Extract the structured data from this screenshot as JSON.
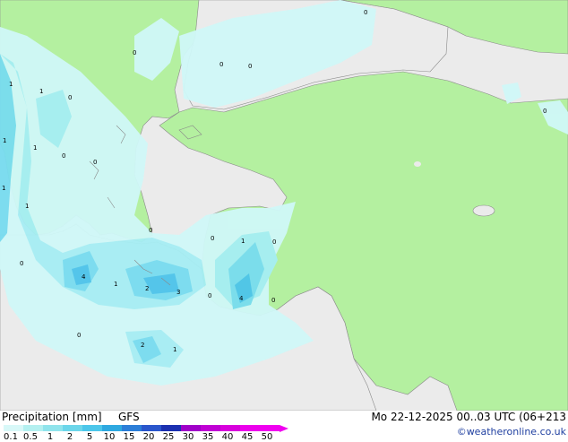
{
  "footer": {
    "title": "Precipitation [mm]",
    "model": "GFS",
    "valid": "Mo 22-12-2025 00..03 UTC (06+213",
    "credit": "©weatheronline.co.uk"
  },
  "legend": {
    "ticks": [
      "0.1",
      "0.5",
      "1",
      "2",
      "5",
      "10",
      "15",
      "20",
      "25",
      "30",
      "35",
      "40",
      "45",
      "50"
    ],
    "colors": [
      "#d8f8f8",
      "#b4f0f0",
      "#90e4ec",
      "#6cd6ea",
      "#4cc6ea",
      "#2ea8e0",
      "#2c7ed8",
      "#2a56cc",
      "#1c30b0",
      "#a000c8",
      "#c000d4",
      "#d800dc",
      "#ec00ec",
      "#f000f0"
    ]
  },
  "map": {
    "colors": {
      "sea": "#ebebeb",
      "land": "#b4f0a0",
      "precip_light": "#d0f8f8",
      "precip_mid": "#a6eef4",
      "precip_heavy": "#78dcf0",
      "precip_max": "#4cc4ea"
    },
    "labels": [
      {
        "t": "0"
      },
      {
        "t": "0"
      },
      {
        "t": "0"
      },
      {
        "t": "0"
      },
      {
        "t": "1"
      },
      {
        "t": "1"
      },
      {
        "t": "0"
      },
      {
        "t": "1"
      },
      {
        "t": "1"
      },
      {
        "t": "0"
      },
      {
        "t": "1"
      },
      {
        "t": "1"
      },
      {
        "t": "0"
      },
      {
        "t": "0"
      },
      {
        "t": "0"
      },
      {
        "t": "1"
      },
      {
        "t": "0"
      },
      {
        "t": "0"
      },
      {
        "t": "4"
      },
      {
        "t": "1"
      },
      {
        "t": "2"
      },
      {
        "t": "3"
      },
      {
        "t": "0"
      },
      {
        "t": "4"
      },
      {
        "t": "0"
      },
      {
        "t": "0"
      },
      {
        "t": "2"
      },
      {
        "t": "1"
      },
      {
        "t": "0"
      }
    ]
  }
}
